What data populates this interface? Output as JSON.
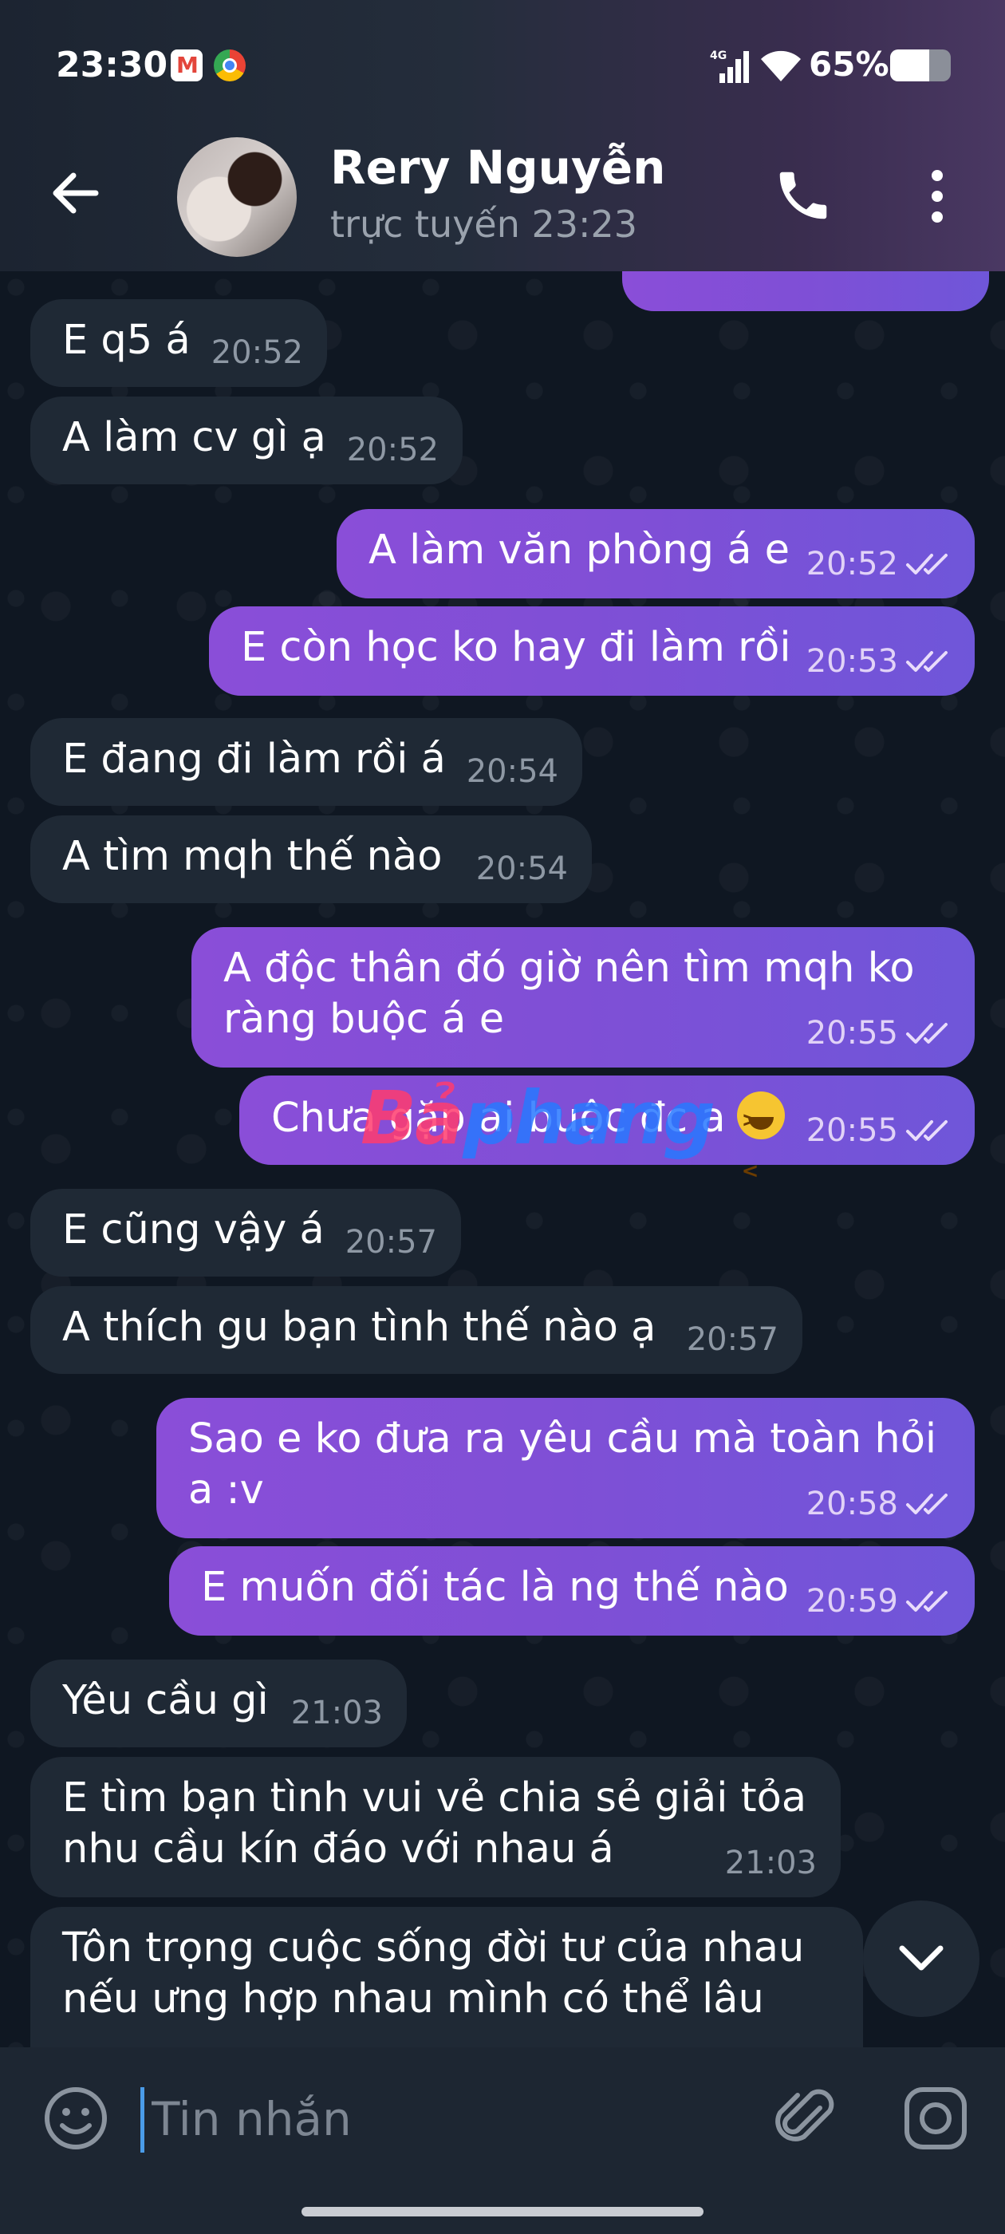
{
  "status_bar": {
    "time": "23:30",
    "battery": "65%",
    "battery_level": 0.65,
    "network": "4G",
    "icons": [
      "gmail-icon",
      "chrome-icon",
      "signal-icon",
      "wifi-icon",
      "battery-icon"
    ]
  },
  "header": {
    "contact_name": "Rery Nguyễn",
    "status": "trực tuyến 23:23",
    "icons": [
      "back-arrow-icon",
      "avatar",
      "phone-icon",
      "more-vertical-icon"
    ]
  },
  "messages": [
    {
      "dir": "in",
      "text": "E q5 á",
      "time": "20:52"
    },
    {
      "dir": "in",
      "text": "A làm cv gì ạ",
      "time": "20:52"
    },
    {
      "dir": "out",
      "text": "A làm văn phòng á e",
      "time": "20:52",
      "read": true
    },
    {
      "dir": "out",
      "text": "E còn học ko hay đi làm rồi",
      "time": "20:53",
      "read": true
    },
    {
      "dir": "in",
      "text": "E đang đi làm rồi á",
      "time": "20:54"
    },
    {
      "dir": "in",
      "text": "A tìm mqh thế nào",
      "time": "20:54"
    },
    {
      "dir": "out",
      "text": "A độc thân đó giờ nên tìm mqh ko ràng buộc á e",
      "time": "20:55",
      "read": true
    },
    {
      "dir": "out",
      "text": "Chưa gặp ai buộc đc a",
      "emoji": "laughing-emoji",
      "time": "20:55",
      "read": true
    },
    {
      "dir": "in",
      "text": "E cũng vậy á",
      "time": "20:57"
    },
    {
      "dir": "in",
      "text": "A thích gu bạn tình thế nào ạ",
      "time": "20:57"
    },
    {
      "dir": "out",
      "text": "Sao e ko đưa ra yêu cầu mà toàn hỏi a :v",
      "time": "20:58",
      "read": true
    },
    {
      "dir": "out",
      "text": "E muốn đối tác là ng thế nào",
      "time": "20:59",
      "read": true
    },
    {
      "dir": "in",
      "text": "Yêu cầu gì",
      "time": "21:03"
    },
    {
      "dir": "in",
      "text": "E tìm bạn tình vui vẻ chia sẻ giải tỏa nhu cầu kín đáo với nhau á",
      "time": "21:03"
    },
    {
      "dir": "in",
      "text": "Tôn trọng cuộc sống đời tư của nhau nếu ưng hợp nhau mình có thể lâu",
      "time": ""
    }
  ],
  "watermark": {
    "part1": "Bả",
    "part2": "phang"
  },
  "composer": {
    "placeholder": "Tin nhắn",
    "icons": [
      "emoji-icon",
      "attach-icon",
      "camera-icon"
    ]
  },
  "colors": {
    "header_bg": "#242d3b",
    "chat_bg": "#0f1722",
    "incoming_bubble": "#1f2935",
    "outgoing_bubble": "#8a4ed8",
    "composer_bg": "#1d2632",
    "caret": "#4a9be8"
  }
}
